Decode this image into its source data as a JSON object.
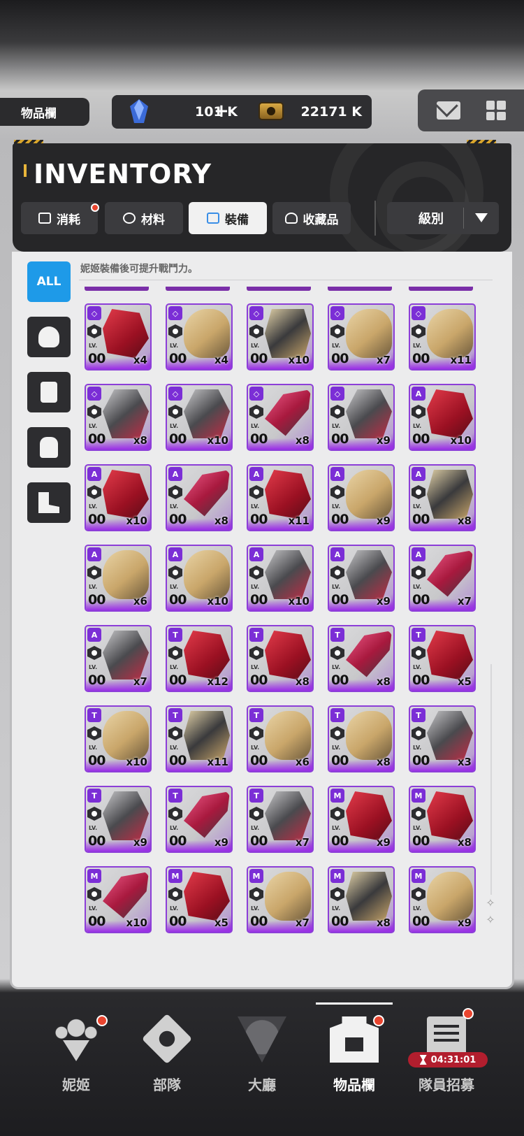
{
  "topbar": {
    "title": "物品欄",
    "gem_value": "101 K",
    "plus_label": "+",
    "coin_value": "22171 K",
    "mail_icon": "mail-icon",
    "menu_icon": "grid-icon"
  },
  "header": {
    "title": "INVENTORY",
    "tabs": [
      {
        "label": "消耗",
        "icon": "consumable-icon",
        "active": false,
        "badge": true
      },
      {
        "label": "材料",
        "icon": "material-icon",
        "active": false,
        "badge": false
      },
      {
        "label": "裝備",
        "icon": "equipment-icon",
        "active": true,
        "badge": false
      },
      {
        "label": "收藏品",
        "icon": "collection-icon",
        "active": false,
        "badge": false
      }
    ],
    "sort": {
      "label": "級別",
      "icon": "dropdown-arrow-icon"
    }
  },
  "filters": {
    "all_label": "ALL",
    "items": [
      "helmet-icon",
      "vest-icon",
      "glove-icon",
      "boot-icon"
    ]
  },
  "hint": "妮姬裝備後可提升戰鬥力。",
  "grid": {
    "level_label": "LV.",
    "level_value": "00",
    "rows": [
      [
        {
          "tier": "◇",
          "qty": "x4",
          "art": "red"
        },
        {
          "tier": "◇",
          "qty": "x4",
          "art": "tan"
        },
        {
          "tier": "◇",
          "qty": "x10",
          "art": "mix"
        },
        {
          "tier": "◇",
          "qty": "x7",
          "art": "tan"
        },
        {
          "tier": "◇",
          "qty": "x11",
          "art": "tan"
        }
      ],
      [
        {
          "tier": "◇",
          "qty": "x8",
          "art": "dark"
        },
        {
          "tier": "◇",
          "qty": "x10",
          "art": "dark"
        },
        {
          "tier": "◇",
          "qty": "x8",
          "art": "pink"
        },
        {
          "tier": "◇",
          "qty": "x9",
          "art": "dark"
        },
        {
          "tier": "A",
          "qty": "x10",
          "art": "red"
        }
      ],
      [
        {
          "tier": "A",
          "qty": "x10",
          "art": "red"
        },
        {
          "tier": "A",
          "qty": "x8",
          "art": "pink"
        },
        {
          "tier": "A",
          "qty": "x11",
          "art": "red"
        },
        {
          "tier": "A",
          "qty": "x9",
          "art": "tan"
        },
        {
          "tier": "A",
          "qty": "x8",
          "art": "mix"
        }
      ],
      [
        {
          "tier": "A",
          "qty": "x6",
          "art": "tan"
        },
        {
          "tier": "A",
          "qty": "x10",
          "art": "tan"
        },
        {
          "tier": "A",
          "qty": "x10",
          "art": "dark"
        },
        {
          "tier": "A",
          "qty": "x9",
          "art": "dark"
        },
        {
          "tier": "A",
          "qty": "x7",
          "art": "pink"
        }
      ],
      [
        {
          "tier": "A",
          "qty": "x7",
          "art": "dark"
        },
        {
          "tier": "T",
          "qty": "x12",
          "art": "red"
        },
        {
          "tier": "T",
          "qty": "x8",
          "art": "red"
        },
        {
          "tier": "T",
          "qty": "x8",
          "art": "pink"
        },
        {
          "tier": "T",
          "qty": "x5",
          "art": "red"
        }
      ],
      [
        {
          "tier": "T",
          "qty": "x10",
          "art": "tan"
        },
        {
          "tier": "T",
          "qty": "x11",
          "art": "mix"
        },
        {
          "tier": "T",
          "qty": "x6",
          "art": "tan"
        },
        {
          "tier": "T",
          "qty": "x8",
          "art": "tan"
        },
        {
          "tier": "T",
          "qty": "x3",
          "art": "dark"
        }
      ],
      [
        {
          "tier": "T",
          "qty": "x9",
          "art": "dark"
        },
        {
          "tier": "T",
          "qty": "x9",
          "art": "pink"
        },
        {
          "tier": "T",
          "qty": "x7",
          "art": "dark"
        },
        {
          "tier": "M",
          "qty": "x9",
          "art": "red"
        },
        {
          "tier": "M",
          "qty": "x8",
          "art": "red"
        }
      ],
      [
        {
          "tier": "M",
          "qty": "x10",
          "art": "pink"
        },
        {
          "tier": "M",
          "qty": "x5",
          "art": "red"
        },
        {
          "tier": "M",
          "qty": "x7",
          "art": "tan"
        },
        {
          "tier": "M",
          "qty": "x8",
          "art": "mix"
        },
        {
          "tier": "M",
          "qty": "x9",
          "art": "tan"
        }
      ]
    ]
  },
  "nav": {
    "items": [
      {
        "label": "妮姬",
        "icon": "nikke-icon",
        "badge": true,
        "active": false
      },
      {
        "label": "部隊",
        "icon": "squad-icon",
        "badge": false,
        "active": false
      },
      {
        "label": "大廳",
        "icon": "lobby-icon",
        "badge": false,
        "active": false
      },
      {
        "label": "物品欄",
        "icon": "inventory-icon",
        "badge": true,
        "active": true
      },
      {
        "label": "隊員招募",
        "icon": "recruit-icon",
        "badge": true,
        "active": false
      }
    ],
    "timer": "04:31:01"
  },
  "colors": {
    "accent": "#1e9ae8",
    "rarity": "#8c3ed8",
    "badge": "#e9452f",
    "timer": "#b21e2e"
  }
}
